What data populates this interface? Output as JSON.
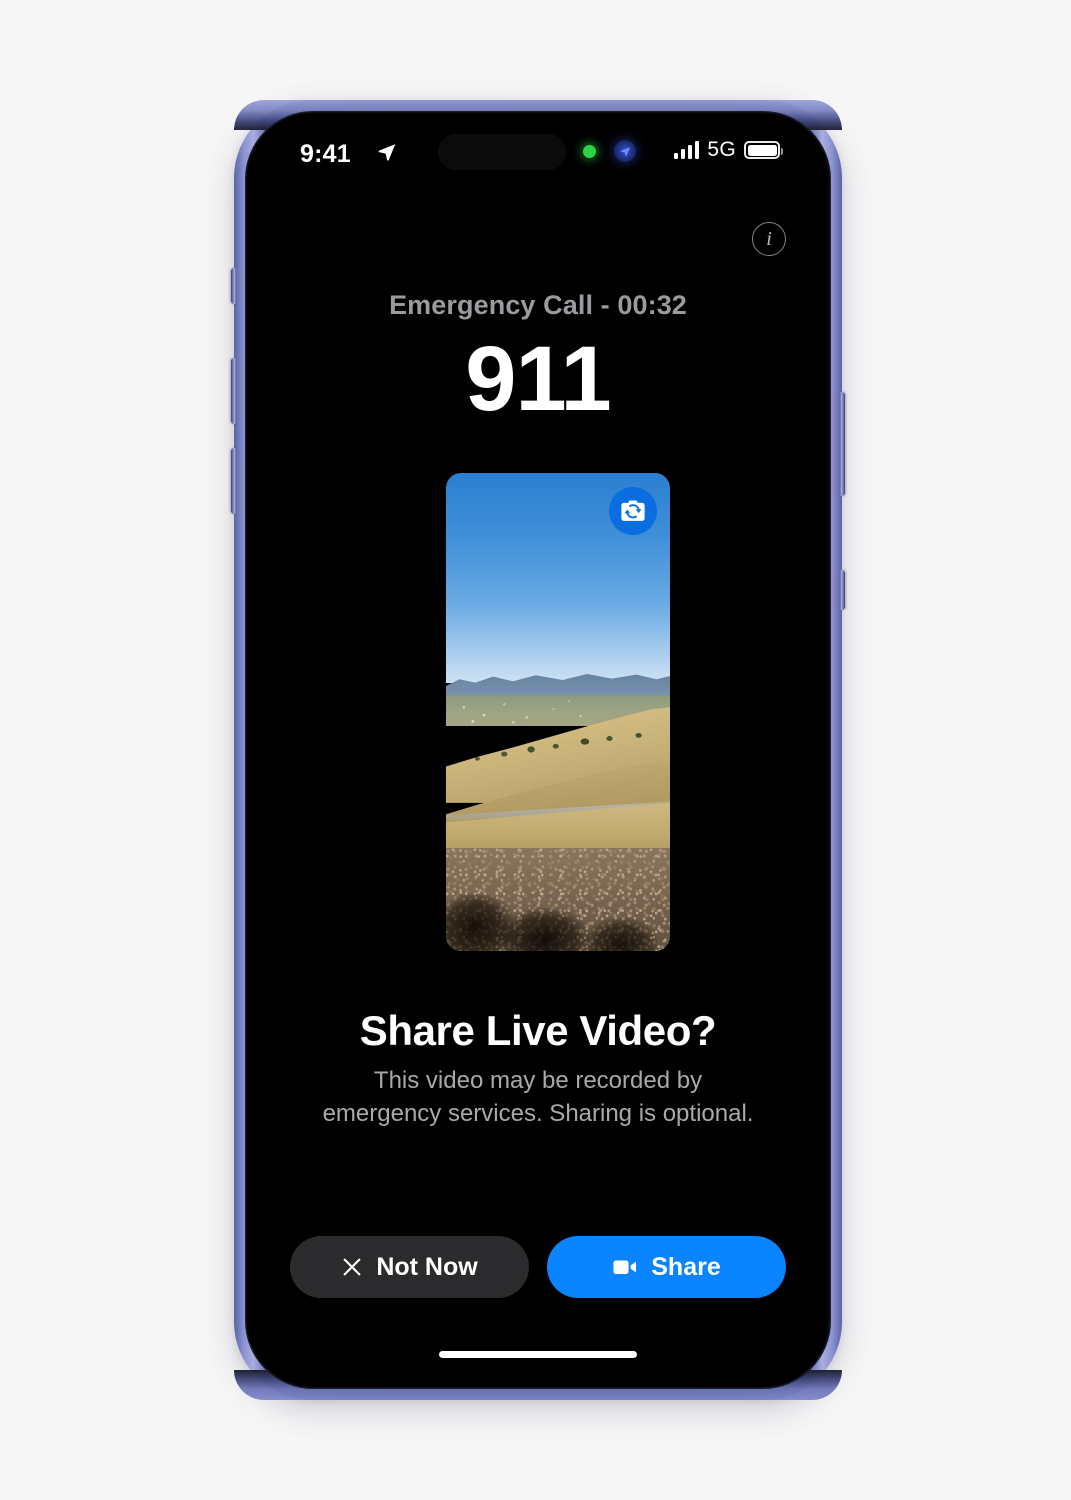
{
  "device": {
    "name": "iPhone",
    "frame_color": "#7d85c6",
    "screen_background": "#000000",
    "buttons": [
      {
        "name": "action-button",
        "side": "left"
      },
      {
        "name": "volume-up-button",
        "side": "left"
      },
      {
        "name": "volume-down-button",
        "side": "left"
      },
      {
        "name": "power-button",
        "side": "right"
      },
      {
        "name": "camera-control-button",
        "side": "right"
      }
    ]
  },
  "status_bar": {
    "time": "9:41",
    "location_icon": "location-arrow-icon",
    "camera_active_icon": "green-dot-camera-active-icon",
    "location_active_icon": "blue-location-active-icon",
    "signal_icon": "cellular-bars-icon",
    "signal_bars": 4,
    "network": "5G",
    "battery_icon": "battery-icon",
    "battery_level": 100
  },
  "header": {
    "info_button_icon": "info-circle-icon",
    "info_glyph": "i"
  },
  "call": {
    "status_label": "Emergency Call - 00:32",
    "status_color": "#9b9b9f",
    "duration": "00:32",
    "number": "911"
  },
  "video_preview": {
    "description": "Live camera preview of golden hillside with blue sky",
    "flip_camera_icon": "camera-flip-icon",
    "flip_camera_color": "#0a6ee0"
  },
  "prompt": {
    "title": "Share Live Video?",
    "subtitle": "This video may be recorded by emergency services. Sharing is optional."
  },
  "actions": {
    "not_now": {
      "label": "Not Now",
      "icon": "close-x-icon",
      "color": "#2b2b2d"
    },
    "share": {
      "label": "Share",
      "icon": "video-camera-icon",
      "color": "#0a84ff"
    }
  },
  "home_indicator": {
    "name": "home-indicator"
  }
}
